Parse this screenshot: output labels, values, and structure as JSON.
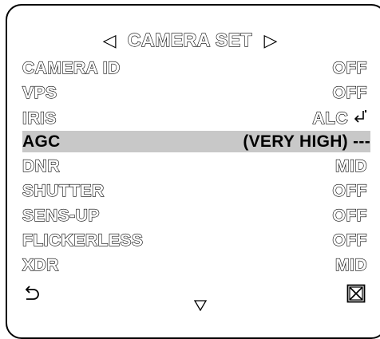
{
  "menu": {
    "title": "CAMERA SET",
    "rows": [
      {
        "label": "CAMERA ID",
        "value": "OFF"
      },
      {
        "label": "VPS",
        "value": "OFF"
      },
      {
        "label": "IRIS",
        "value": "ALC"
      },
      {
        "label": "AGC",
        "value": "(VERY HIGH) ---"
      },
      {
        "label": "DNR",
        "value": "MID"
      },
      {
        "label": "SHUTTER",
        "value": "OFF"
      },
      {
        "label": "SENS-UP",
        "value": "OFF"
      },
      {
        "label": "FLICKERLESS",
        "value": "OFF"
      },
      {
        "label": "XDR",
        "value": "MID"
      }
    ]
  },
  "icons": {
    "left_arrow": "left-triangle-icon",
    "right_arrow": "right-triangle-icon",
    "enter": "enter-icon",
    "return": "return-icon",
    "close": "close-box-icon",
    "down": "down-triangle-icon"
  },
  "colors": {
    "selected_background": "#c8c8c8",
    "text": "#000000",
    "background": "#ffffff"
  }
}
